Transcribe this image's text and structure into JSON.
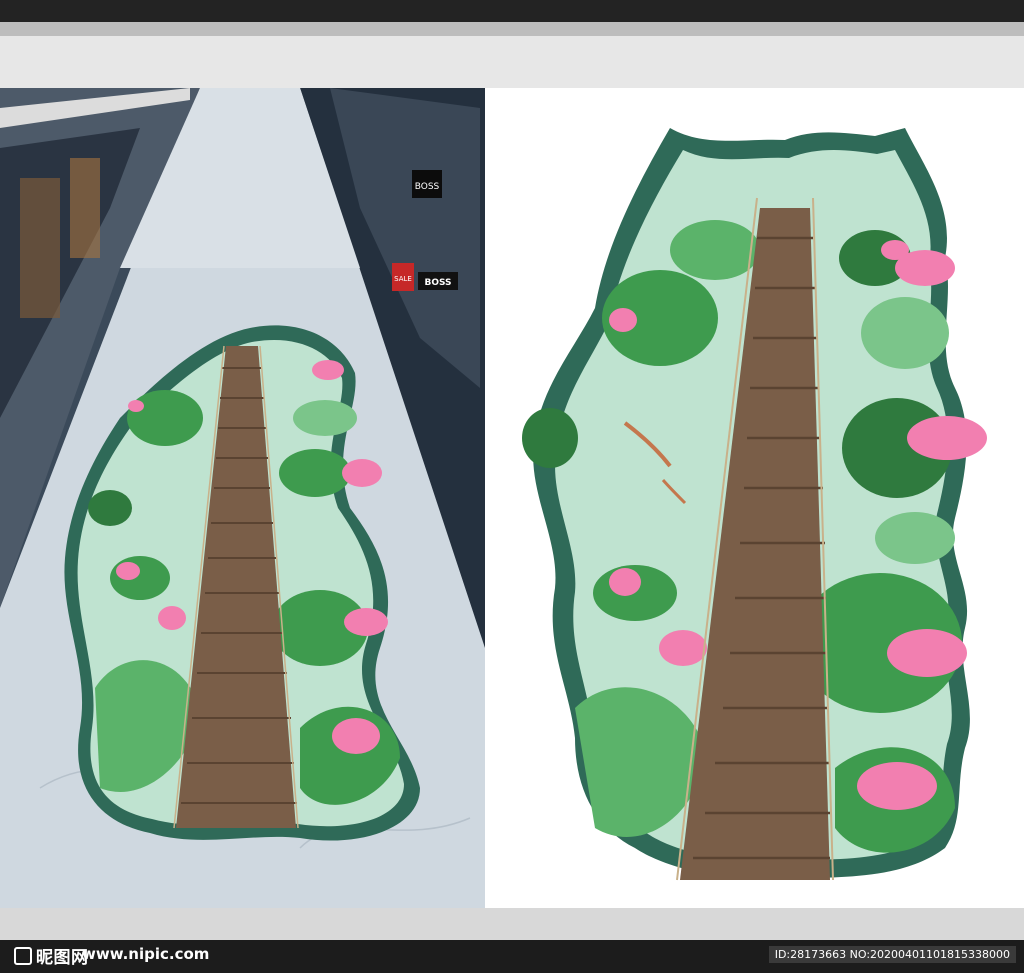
{
  "watermark": {
    "logo_text": "昵图网",
    "site_text": "www.nipic.com",
    "id_text": "ID:28173663 NO:20200401101815338000"
  },
  "storefront": {
    "sign_main": "BOSS",
    "sign_small": "BOSS",
    "sale_sign": "SALE"
  },
  "colors": {
    "water": "#bfe3d0",
    "rim": "#2f6a58",
    "lotus": "#f27fb0",
    "leaf": "#3e9b4e",
    "plank": "#8a6b52",
    "floor": "#cfd8e0"
  }
}
